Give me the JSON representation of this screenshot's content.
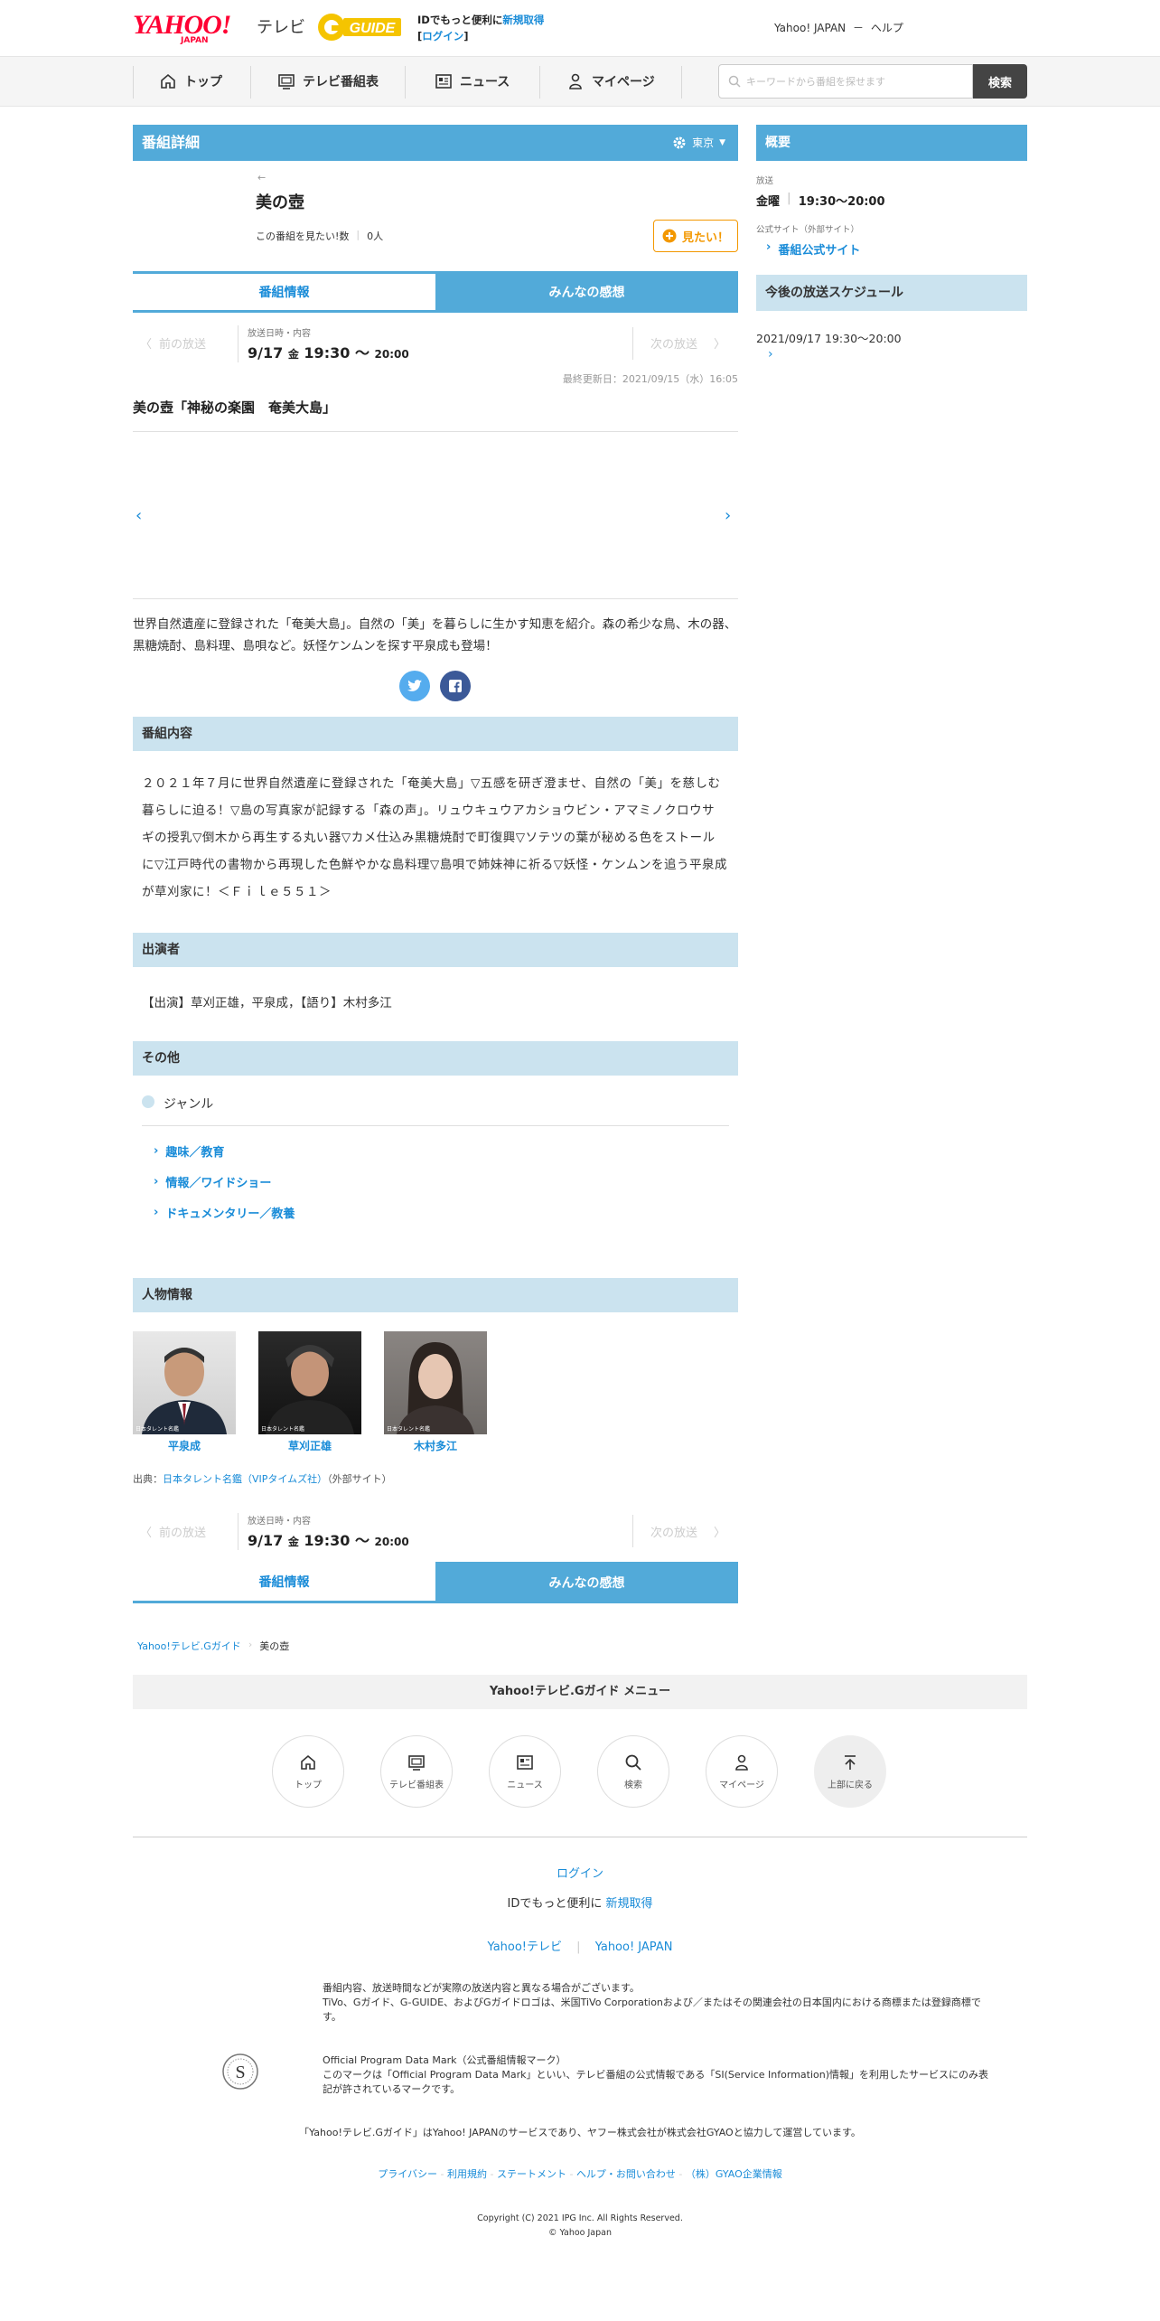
{
  "header": {
    "logo_yahoo": "YAHOO!",
    "logo_japan": "JAPAN",
    "logo_tv": "テレビ",
    "logo_gguide": "G GUIDE",
    "promo_line1": "IDでもっと便利に",
    "promo_register": "新規取得",
    "promo_login": "ログイン",
    "yahoo_japan_link": "Yahoo! JAPAN",
    "help_link": "ヘルプ"
  },
  "nav": {
    "items": [
      "トップ",
      "テレビ番組表",
      "ニュース",
      "マイページ"
    ],
    "search_placeholder": "キーワードから番組を探せます",
    "search_button": "検索"
  },
  "program": {
    "section_title": "番組詳細",
    "region": "東京",
    "back_arrow": "←",
    "title": "美の壺",
    "want_count_label": "この番組を見たい!数",
    "want_count": "0人",
    "want_button": "見たい！",
    "tab_info": "番組情報",
    "tab_reviews": "みんなの感想",
    "prev_label": "前の放送",
    "next_label": "次の放送",
    "air_label": "放送日時・内容",
    "air_date": "9/17",
    "air_day": "金",
    "air_start": "19:30",
    "air_tilde": "〜",
    "air_end": "20:00",
    "last_updated": "最終更新日：2021/09/15（水）16:05",
    "episode_title": "美の壺「神秘の楽園　奄美大島」",
    "summary": "世界自然遺産に登録された「奄美大島」。自然の「美」を暮らしに生かす知恵を紹介。森の希少な鳥、木の器、黒糖焼酎、島料理、島唄など。妖怪ケンムンを探す平泉成も登場！",
    "content_head": "番組内容",
    "content_text": "２０２１年７月に世界自然遺産に登録された「奄美大島」▽五感を研ぎ澄ませ、自然の「美」を慈しむ暮らしに迫る！▽島の写真家が記録する「森の声」。リュウキュウアカショウビン・アマミノクロウサギの授乳▽倒木から再生する丸い器▽カメ仕込み黒糖焼酎で町復興▽ソテツの葉が秘める色をストールに▽江戸時代の書物から再現した色鮮やかな島料理▽島唄で姉妹神に祈る▽妖怪・ケンムンを追う平泉成が草刈家に！＜Ｆｉｌｅ５５１＞",
    "cast_head": "出演者",
    "cast_text": "【出演】草刈正雄，平泉成，【語り】木村多江",
    "other_head": "その他",
    "genre_label": "ジャンル",
    "genres": [
      "趣味／教育",
      "情報／ワイドショー",
      "ドキュメンタリー／教養"
    ],
    "people_head": "人物情報",
    "people": [
      "平泉成",
      "草刈正雄",
      "木村多江"
    ],
    "photo_credit": "日本タレント名鑑",
    "source_label": "出典：",
    "source_link": "日本タレント名鑑（VIPタイムズ社）",
    "source_suffix": "（外部サイト）"
  },
  "breadcrumb": {
    "home": "Yahoo!テレビ.Gガイド",
    "current": "美の壺"
  },
  "footer_menu": {
    "title": "Yahoo!テレビ.Gガイド メニュー",
    "items": [
      "トップ",
      "テレビ番組表",
      "ニュース",
      "検索",
      "マイページ",
      "上部に戻る"
    ]
  },
  "footer": {
    "login": "ログイン",
    "register_prefix": "IDでもっと便利に",
    "register_link": "新規取得",
    "link_tv": "Yahoo!テレビ",
    "link_japan": "Yahoo! JAPAN",
    "disclaimer1": "番組内容、放送時間などが実際の放送内容と異なる場合がございます。",
    "disclaimer2": "TiVo、Gガイド、G-GUIDE、およびGガイドロゴは、米国TiVo Corporationおよび／またはその関連会社の日本国内における商標または登録商標です。",
    "opdm_title": "Official Program Data Mark（公式番組情報マーク）",
    "opdm_text": "このマークは「Official Program Data Mark」といい、テレビ番組の公式情報である「SI(Service Information)情報」を利用したサービスにのみ表記が許されているマークです。",
    "service_note": "「Yahoo!テレビ.Gガイド」はYahoo! JAPANのサービスであり、ヤフー株式会社が株式会社GYAOと協力して運営しています。",
    "links": [
      "プライバシー",
      "利用規約",
      "ステートメント",
      "ヘルプ・お問い合わせ",
      "（株）GYAO企業情報"
    ],
    "copyright1": "Copyright (C) 2021 IPG Inc. All Rights Reserved.",
    "copyright2": "© Yahoo Japan"
  },
  "sidebar": {
    "overview_head": "概要",
    "broadcast_label": "放送",
    "broadcast_day": "金曜",
    "broadcast_time": "19:30～20:00",
    "official_label": "公式サイト（外部サイト）",
    "official_link": "番組公式サイト",
    "schedule_head": "今後の放送スケジュール",
    "schedule_item": "2021/09/17 19:30～20:00"
  },
  "colors": {
    "accent": "#52aad9",
    "section_bg": "#cbe3ef",
    "link": "#1a8cd8",
    "want_orange": "#f39800"
  }
}
